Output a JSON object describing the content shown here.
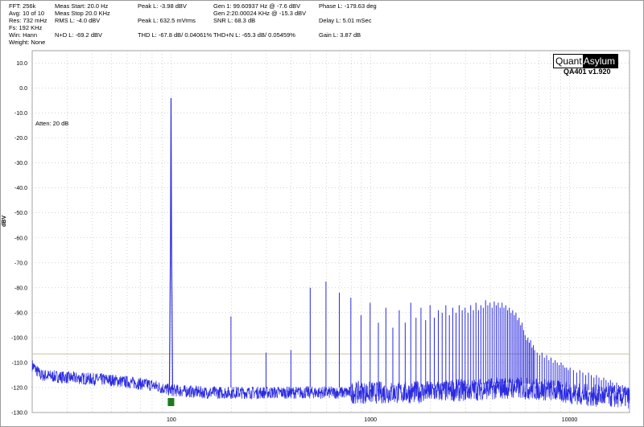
{
  "header": {
    "col1": [
      "FFT: 256k",
      "Avg: 10 of 10",
      "Res: 732 mHz",
      "Fs: 192 KHz",
      "Win: Hann",
      "Weight: None"
    ],
    "col2": [
      "Meas Start: 20.0 Hz",
      "Meas Stop 20.0 KHz",
      "RMS L: -4.0 dBV",
      "N+D L: -69.2 dBV"
    ],
    "col3": [
      "Peak L: -3.98 dBV",
      "Peak L: 632.5 mVrms",
      "THD L: -67.8 dB/ 0.04061%"
    ],
    "col4": [
      "Gen 1: 99.60937 Hz @ -7.6  dBV",
      "Gen 2:20.00024 KHz @ -15.3  dBV",
      "SNR L: 68.3 dB",
      "THD+N L: -65.3 dB/ 0.05459%"
    ],
    "col5": [
      "Phase L: -179.63 deg",
      "Delay L: 5.01 mSec",
      "Gain L: 3.87 dB"
    ]
  },
  "brand": {
    "left": "Quant",
    "right": "Asylum",
    "version": "QA401 v1.920"
  },
  "annotation": "Atten: 20 dB",
  "colors": {
    "trace": "#2a2ae0",
    "grid": "#b8b8b8",
    "ref_line": "#c9c2a0",
    "marker": "#1d7a1d"
  },
  "chart_data": {
    "type": "line",
    "ylabel": "dBV",
    "xscale": "log",
    "xlim": [
      20,
      20000
    ],
    "ylim": [
      -130,
      15
    ],
    "yticks": [
      10,
      0,
      -10,
      -20,
      -30,
      -40,
      -50,
      -60,
      -70,
      -80,
      -90,
      -100,
      -110,
      -120,
      -130
    ],
    "ytick_labels": [
      "10.0",
      "0.0",
      "-10.0",
      "-20.0",
      "-30.0",
      "-40.0",
      "-50.0",
      "-60.0",
      "-70.0",
      "-80.0",
      "-90.0",
      "-100.0",
      "-110.0",
      "-120.0",
      "-130.0"
    ],
    "xticks": [
      100,
      1000,
      10000
    ],
    "xtick_labels": [
      "100",
      "1000",
      "10000"
    ],
    "reference_line_db": -106.5,
    "noise_floor": [
      [
        20,
        -111
      ],
      [
        22,
        -115
      ],
      [
        30,
        -116
      ],
      [
        50,
        -117
      ],
      [
        80,
        -119
      ],
      [
        98,
        -121
      ],
      [
        150,
        -122
      ],
      [
        300,
        -122
      ],
      [
        800,
        -122
      ],
      [
        1500,
        -122
      ],
      [
        3000,
        -121
      ],
      [
        5000,
        -120
      ],
      [
        8000,
        -121
      ],
      [
        12000,
        -123
      ],
      [
        20000,
        -124
      ]
    ],
    "fundamental": {
      "freq": 99.6,
      "level": -4.0
    },
    "harmonics": [
      {
        "freq": 199.2,
        "level": -91.5
      },
      {
        "freq": 298.8,
        "level": -106
      },
      {
        "freq": 398.4,
        "level": -105
      },
      {
        "freq": 498.0,
        "level": -80
      },
      {
        "freq": 597.7,
        "level": -77.5
      },
      {
        "freq": 697.3,
        "level": -82
      },
      {
        "freq": 796.9,
        "level": -84
      },
      {
        "freq": 896.5,
        "level": -91
      },
      {
        "freq": 996.1,
        "level": -86
      },
      {
        "freq": 1095.7,
        "level": -94
      },
      {
        "freq": 1195.3,
        "level": -88
      },
      {
        "freq": 1294.9,
        "level": -96
      },
      {
        "freq": 1394.5,
        "level": -89
      },
      {
        "freq": 1494.1,
        "level": -94
      },
      {
        "freq": 1593.8,
        "level": -86
      },
      {
        "freq": 1693.4,
        "level": -92
      },
      {
        "freq": 1793.0,
        "level": -88
      },
      {
        "freq": 1892.6,
        "level": -93
      },
      {
        "freq": 1992.2,
        "level": -87
      },
      {
        "freq": 2091.8,
        "level": -92
      },
      {
        "freq": 2191.4,
        "level": -89
      },
      {
        "freq": 2291.0,
        "level": -90
      },
      {
        "freq": 2390.6,
        "level": -87
      },
      {
        "freq": 2490.2,
        "level": -91
      },
      {
        "freq": 2589.8,
        "level": -88
      },
      {
        "freq": 2689.5,
        "level": -90
      },
      {
        "freq": 2789.1,
        "level": -87
      },
      {
        "freq": 2888.7,
        "level": -89
      },
      {
        "freq": 2988.3,
        "level": -88
      },
      {
        "freq": 3087.9,
        "level": -90
      },
      {
        "freq": 3187.5,
        "level": -87
      },
      {
        "freq": 3287.1,
        "level": -89
      },
      {
        "freq": 3386.7,
        "level": -86
      },
      {
        "freq": 3486.3,
        "level": -89
      },
      {
        "freq": 3585.9,
        "level": -87
      },
      {
        "freq": 3685.5,
        "level": -88
      },
      {
        "freq": 3785.2,
        "level": -85
      },
      {
        "freq": 3884.8,
        "level": -87
      },
      {
        "freq": 3984.4,
        "level": -86
      },
      {
        "freq": 4084.0,
        "level": -88
      },
      {
        "freq": 4183.6,
        "level": -85.5
      },
      {
        "freq": 4283.2,
        "level": -87
      },
      {
        "freq": 4382.8,
        "level": -86
      },
      {
        "freq": 4482.4,
        "level": -88
      },
      {
        "freq": 4582.0,
        "level": -86
      },
      {
        "freq": 4681.6,
        "level": -88
      },
      {
        "freq": 4781.3,
        "level": -87
      },
      {
        "freq": 4880.9,
        "level": -89
      },
      {
        "freq": 4980.5,
        "level": -88
      },
      {
        "freq": 5080.1,
        "level": -90
      },
      {
        "freq": 5179.7,
        "level": -89
      },
      {
        "freq": 5279.3,
        "level": -91
      },
      {
        "freq": 5378.9,
        "level": -90
      },
      {
        "freq": 5478.5,
        "level": -93
      },
      {
        "freq": 5578.1,
        "level": -92
      },
      {
        "freq": 5677.7,
        "level": -95
      },
      {
        "freq": 5777.3,
        "level": -94
      },
      {
        "freq": 5877.0,
        "level": -97
      },
      {
        "freq": 5976.6,
        "level": -99
      },
      {
        "freq": 6076.2,
        "level": -101
      },
      {
        "freq": 6175.8,
        "level": -100
      },
      {
        "freq": 6275.4,
        "level": -102
      },
      {
        "freq": 6375.0,
        "level": -101
      },
      {
        "freq": 6474.6,
        "level": -104
      },
      {
        "freq": 6574.2,
        "level": -103
      },
      {
        "freq": 6673.8,
        "level": -105
      },
      {
        "freq": 6873.0,
        "level": -106
      },
      {
        "freq": 7072.3,
        "level": -107
      },
      {
        "freq": 7271.5,
        "level": -106
      },
      {
        "freq": 7470.7,
        "level": -108
      },
      {
        "freq": 7669.9,
        "level": -107
      },
      {
        "freq": 7869.1,
        "level": -109
      },
      {
        "freq": 8068.4,
        "level": -108
      },
      {
        "freq": 8267.6,
        "level": -110
      },
      {
        "freq": 8466.8,
        "level": -109
      },
      {
        "freq": 8666.0,
        "level": -110
      },
      {
        "freq": 8865.2,
        "level": -111
      },
      {
        "freq": 9064.5,
        "level": -110
      },
      {
        "freq": 9263.7,
        "level": -111
      },
      {
        "freq": 9462.9,
        "level": -112
      },
      {
        "freq": 9662.1,
        "level": -112
      },
      {
        "freq": 9861.3,
        "level": -113
      },
      {
        "freq": 10060.5,
        "level": -112
      },
      {
        "freq": 10458.9,
        "level": -113
      },
      {
        "freq": 10857.4,
        "level": -114
      },
      {
        "freq": 11255.8,
        "level": -113
      },
      {
        "freq": 11654.3,
        "level": -114
      },
      {
        "freq": 12052.7,
        "level": -115
      },
      {
        "freq": 12451.1,
        "level": -114
      },
      {
        "freq": 12849.6,
        "level": -115
      },
      {
        "freq": 13248.0,
        "level": -116
      },
      {
        "freq": 13646.5,
        "level": -115
      },
      {
        "freq": 14044.9,
        "level": -116
      },
      {
        "freq": 14443.4,
        "level": -117
      },
      {
        "freq": 14841.8,
        "level": -116
      },
      {
        "freq": 15240.2,
        "level": -117
      },
      {
        "freq": 15638.7,
        "level": -118
      },
      {
        "freq": 16037.1,
        "level": -117
      },
      {
        "freq": 16435.6,
        "level": -118
      },
      {
        "freq": 16834.0,
        "level": -119
      },
      {
        "freq": 17232.4,
        "level": -118
      },
      {
        "freq": 17630.9,
        "level": -119
      },
      {
        "freq": 18029.3,
        "level": -120
      },
      {
        "freq": 18427.7,
        "level": -119
      },
      {
        "freq": 18826.2,
        "level": -120
      },
      {
        "freq": 19224.6,
        "level": -120
      },
      {
        "freq": 19623.1,
        "level": -120
      }
    ],
    "marker_freq": 99.6,
    "grid": true
  }
}
